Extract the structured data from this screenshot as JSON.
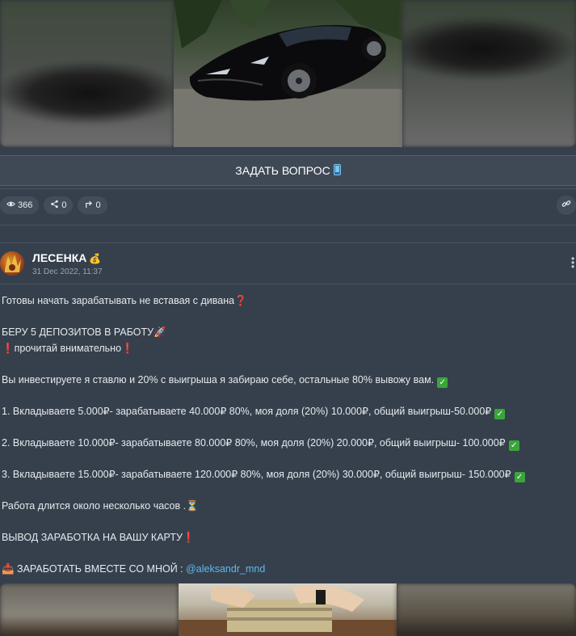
{
  "ask_button": {
    "label": "ЗАДАТЬ ВОПРОС",
    "icon": "phone-icon"
  },
  "stats": {
    "views": "366",
    "shares": "0",
    "forwards": "0"
  },
  "post": {
    "author": "ЛЕСЕНКА",
    "author_badge": "💰",
    "date": "31 Dec 2022, 11:37",
    "lines": [
      "Готовы начать зарабатывать не вставая с дивана❓",
      "",
      "БЕРУ 5 ДЕПОЗИТОВ В РАБОТУ🚀",
      "❗прочитай внимательно❗",
      "",
      "Вы инвестируете я ставлю и 20% с выигрыша я забираю себе, остальные 80% вывожу вам.",
      "",
      "1. Вкладываете 5.000₽- зарабатываете 40.000₽ 80%, моя доля (20%) 10.000₽, общий выигрыш-50.000₽",
      "",
      "2. Вкладываете 10.000₽- зарабатываете 80.000₽ 80%, моя доля (20%) 20.000₽, общий выигрыш- 100.000₽",
      "",
      "3. Вкладываете 15.000₽- зарабатываете 120.000₽ 80%, моя доля (20%) 30.000₽, общий выигрыш- 150.000₽",
      "",
      "Работа длится около несколько часов .⏳",
      "",
      "ВЫВОД ЗАРАБОТКА НА ВАШУ КАРТУ❗",
      "",
      "📥 ЗАРАБОТАТЬ ВМЕСТЕ СО МНОЙ : "
    ],
    "mention": "@aleksandr_mnd",
    "check_mark": "✓"
  },
  "colors": {
    "background": "#36404d",
    "pill": "#434d5a",
    "check": "#3aa63a",
    "mention": "#5fb8ea",
    "red": "#e03b3b"
  }
}
